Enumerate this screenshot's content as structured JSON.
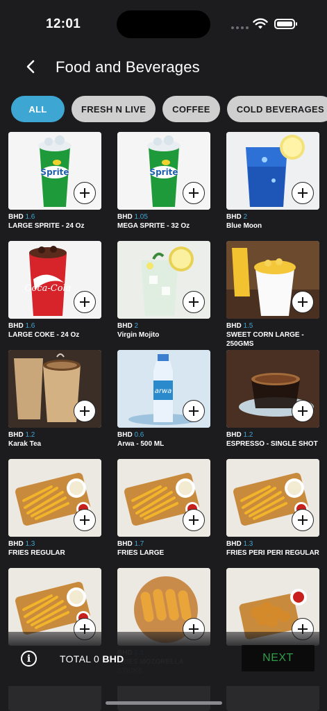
{
  "status": {
    "time": "12:01"
  },
  "header": {
    "title": "Food and Beverages"
  },
  "tabs": [
    {
      "label": "ALL",
      "active": true
    },
    {
      "label": "FRESH N LIVE",
      "active": false
    },
    {
      "label": "COFFEE",
      "active": false
    },
    {
      "label": "COLD BEVERAGES",
      "active": false
    }
  ],
  "currency": "BHD",
  "products": [
    {
      "price": "1.6",
      "name": "LARGE SPRITE - 24 Oz",
      "image": "sprite-cup-icon"
    },
    {
      "price": "1.05",
      "name": "MEGA SPRITE - 32 Oz",
      "image": "sprite-cup-icon"
    },
    {
      "price": "2",
      "name": "Blue Moon",
      "image": "blue-drink-icon"
    },
    {
      "price": "1.6",
      "name": "LARGE COKE - 24 Oz",
      "image": "coke-cup-icon"
    },
    {
      "price": "2",
      "name": "Virgin Mojito",
      "image": "mojito-icon"
    },
    {
      "price": "1.5",
      "name": "SWEET CORN LARGE - 250GMS",
      "image": "corn-cup-icon"
    },
    {
      "price": "1.2",
      "name": "Karak Tea",
      "image": "tea-cup-icon"
    },
    {
      "price": "0.6",
      "name": "Arwa - 500 ML",
      "image": "water-bottle-icon"
    },
    {
      "price": "1.2",
      "name": "ESPRESSO - SINGLE SHOT",
      "image": "espresso-icon"
    },
    {
      "price": "1.3",
      "name": "FRIES REGULAR",
      "image": "fries-tray-icon"
    },
    {
      "price": "1.7",
      "name": "FRIES LARGE",
      "image": "fries-tray-icon"
    },
    {
      "price": "1.3",
      "name": "FRIES PERI PERI REGULAR",
      "image": "fries-tray-icon"
    },
    {
      "price": "",
      "name": "",
      "image": "fries-tray-icon"
    },
    {
      "price": "2.1",
      "name": "FRIES MOZORELLA STICKS",
      "image": "mozzarella-sticks-icon"
    },
    {
      "price": "",
      "name": "",
      "image": "popcorn-chicken-icon"
    }
  ],
  "footer": {
    "total_label": "TOTAL",
    "total_value": "0",
    "total_currency": "BHD",
    "next_label": "NEXT"
  },
  "colors": {
    "accent": "#3ea6d3",
    "next_text": "#2f9e4a",
    "background": "#1c1c1f"
  }
}
